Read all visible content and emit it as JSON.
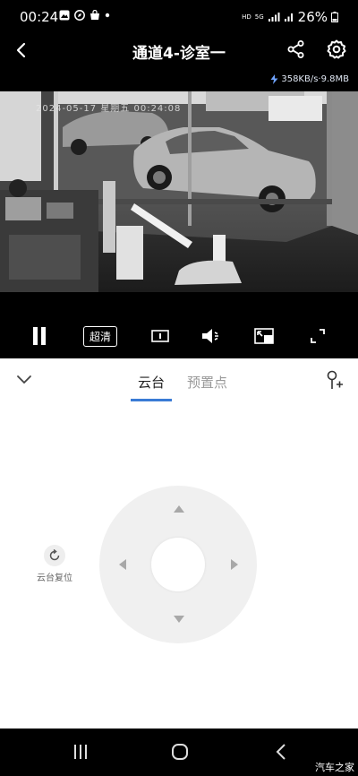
{
  "status_bar": {
    "time": "00:24",
    "network_hd": "HD",
    "network_type": "5G",
    "battery": "26%"
  },
  "header": {
    "title": "通道4-诊室一"
  },
  "stream": {
    "rate": "358KB/s·9.8MB",
    "osd_text": "2024-05-17 星期五 00:24:08"
  },
  "controls": {
    "quality_label": "超清"
  },
  "panel": {
    "tabs": [
      {
        "label": "云台",
        "active": true
      },
      {
        "label": "预置点",
        "active": false
      }
    ],
    "reset_label": "云台复位",
    "accent_color": "#3a7bd5"
  },
  "watermark": "汽车之家"
}
